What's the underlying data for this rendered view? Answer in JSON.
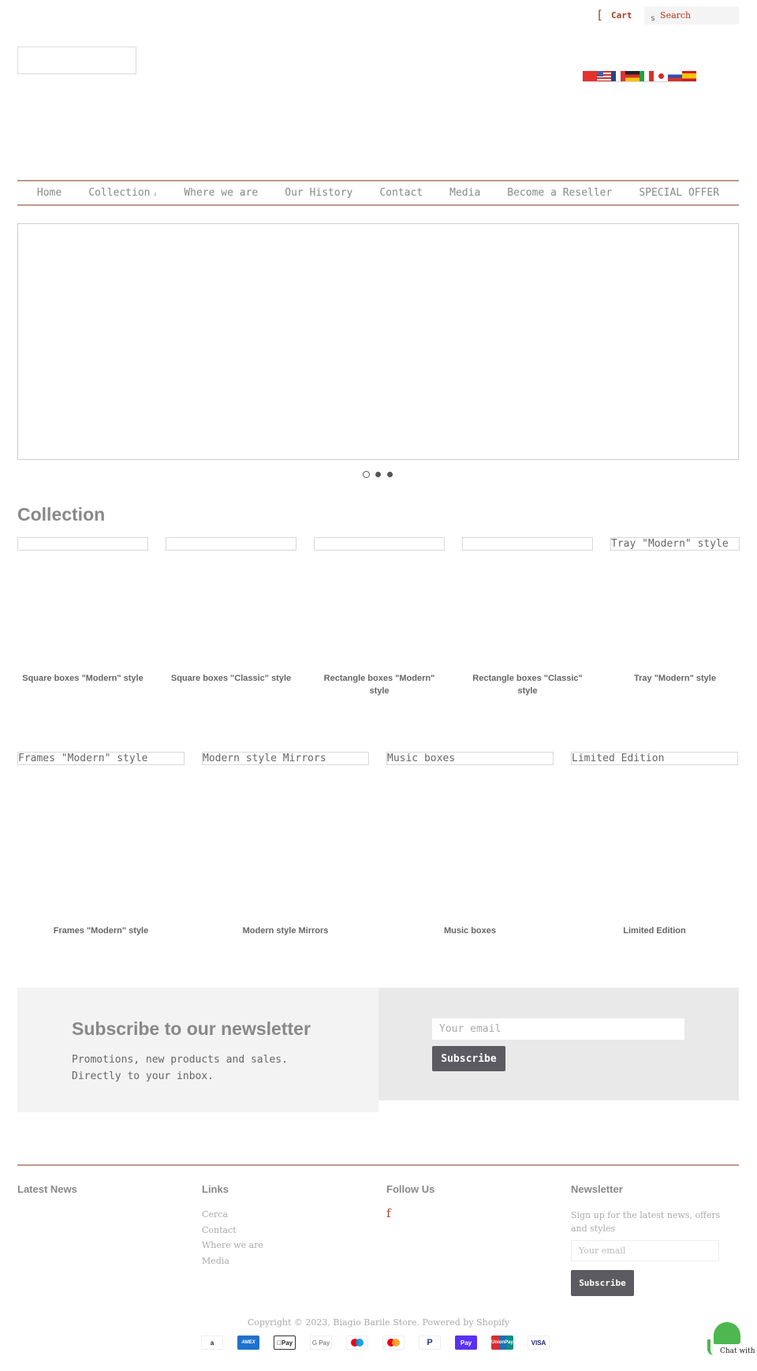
{
  "header": {
    "cart_icon": "[",
    "cart_label": "Cart",
    "search_icon": "s",
    "search_placeholder": "Search",
    "languages": [
      "Chinese",
      "English",
      "French",
      "German",
      "Italian",
      "Japanese",
      "Russian",
      "Spanish"
    ]
  },
  "nav": {
    "items": [
      {
        "label": "Home"
      },
      {
        "label": "Collection",
        "caret": "↓"
      },
      {
        "label": "Where we are"
      },
      {
        "label": "Our History"
      },
      {
        "label": "Contact"
      },
      {
        "label": "Media"
      },
      {
        "label": "Become a Reseller"
      },
      {
        "label": "SPECIAL OFFER"
      }
    ]
  },
  "slideshow": {
    "slide_count": 3,
    "active_slide": 1
  },
  "collection": {
    "title": "Collection",
    "row1": [
      {
        "alt": "",
        "label": "Square boxes \"Modern\" style"
      },
      {
        "alt": "",
        "label": "Square boxes \"Classic\" style"
      },
      {
        "alt": "",
        "label": "Rectangle boxes \"Modern\" style"
      },
      {
        "alt": "",
        "label": "Rectangle boxes \"Classic\" style"
      },
      {
        "alt": "Tray \"Modern\" style",
        "label": "Tray \"Modern\" style"
      }
    ],
    "row2": [
      {
        "alt": "Frames \"Modern\" style",
        "label": "Frames \"Modern\" style"
      },
      {
        "alt": "Modern style Mirrors",
        "label": "Modern style Mirrors"
      },
      {
        "alt": "Music boxes",
        "label": "Music boxes"
      },
      {
        "alt": "Limited Edition",
        "label": "Limited Edition"
      }
    ]
  },
  "newsletter_band": {
    "title": "Subscribe to our newsletter",
    "line1": "Promotions, new products and sales.",
    "line2": "Directly to your inbox.",
    "email_placeholder": "Your email",
    "button_label": "Subscribe"
  },
  "footer": {
    "latest_news_heading": "Latest News",
    "links_heading": "Links",
    "links": [
      "Cerca",
      "Contact",
      "Where we are",
      "Media"
    ],
    "follow_heading": "Follow Us",
    "facebook_icon": "f",
    "newsletter_heading": "Newsletter",
    "newsletter_text": "Sign up for the latest news, offers and styles",
    "newsletter_placeholder": "Your email",
    "newsletter_button": "Subscribe",
    "copyright": "Copyright © 2023, Biagio Barile Store. Powered by Shopify",
    "payments": [
      "Amazon",
      "American Express",
      "Apple Pay",
      "Google Pay",
      "Maestro",
      "Mastercard",
      "PayPal",
      "Shop Pay",
      "Union Pay",
      "Visa"
    ]
  },
  "chat": {
    "label": "Chat with"
  },
  "colors": {
    "accent": "#b03a1e",
    "nav_border": "#c09a8c",
    "button_dark": "#5b5b61",
    "chat_green": "#4cb84f"
  }
}
